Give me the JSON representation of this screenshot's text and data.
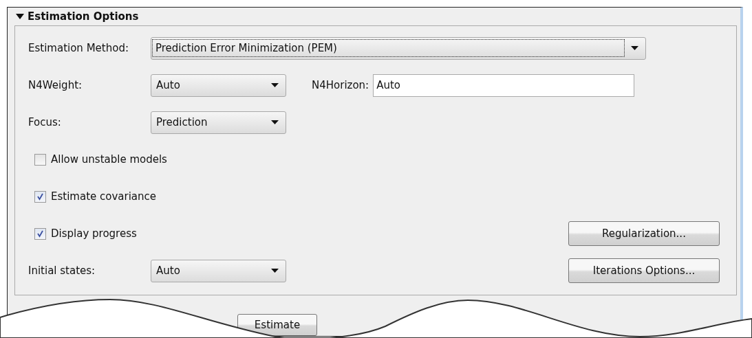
{
  "section": {
    "title": "Estimation Options",
    "expanded": true
  },
  "method": {
    "label": "Estimation Method:",
    "value": "Prediction Error Minimization (PEM)"
  },
  "n4weight": {
    "label": "N4Weight:",
    "value": "Auto"
  },
  "n4horizon": {
    "label": "N4Horizon:",
    "value": "Auto"
  },
  "focus": {
    "label": "Focus:",
    "value": "Prediction"
  },
  "checkboxes": [
    {
      "label": "Allow unstable models",
      "checked": false
    },
    {
      "label": "Estimate covariance",
      "checked": true
    },
    {
      "label": "Display progress",
      "checked": true
    }
  ],
  "initial_states": {
    "label": "Initial states:",
    "value": "Auto"
  },
  "buttons": [
    "Regularization...",
    "Iterations Options..."
  ],
  "footer_buttons": [
    "Estimate"
  ]
}
